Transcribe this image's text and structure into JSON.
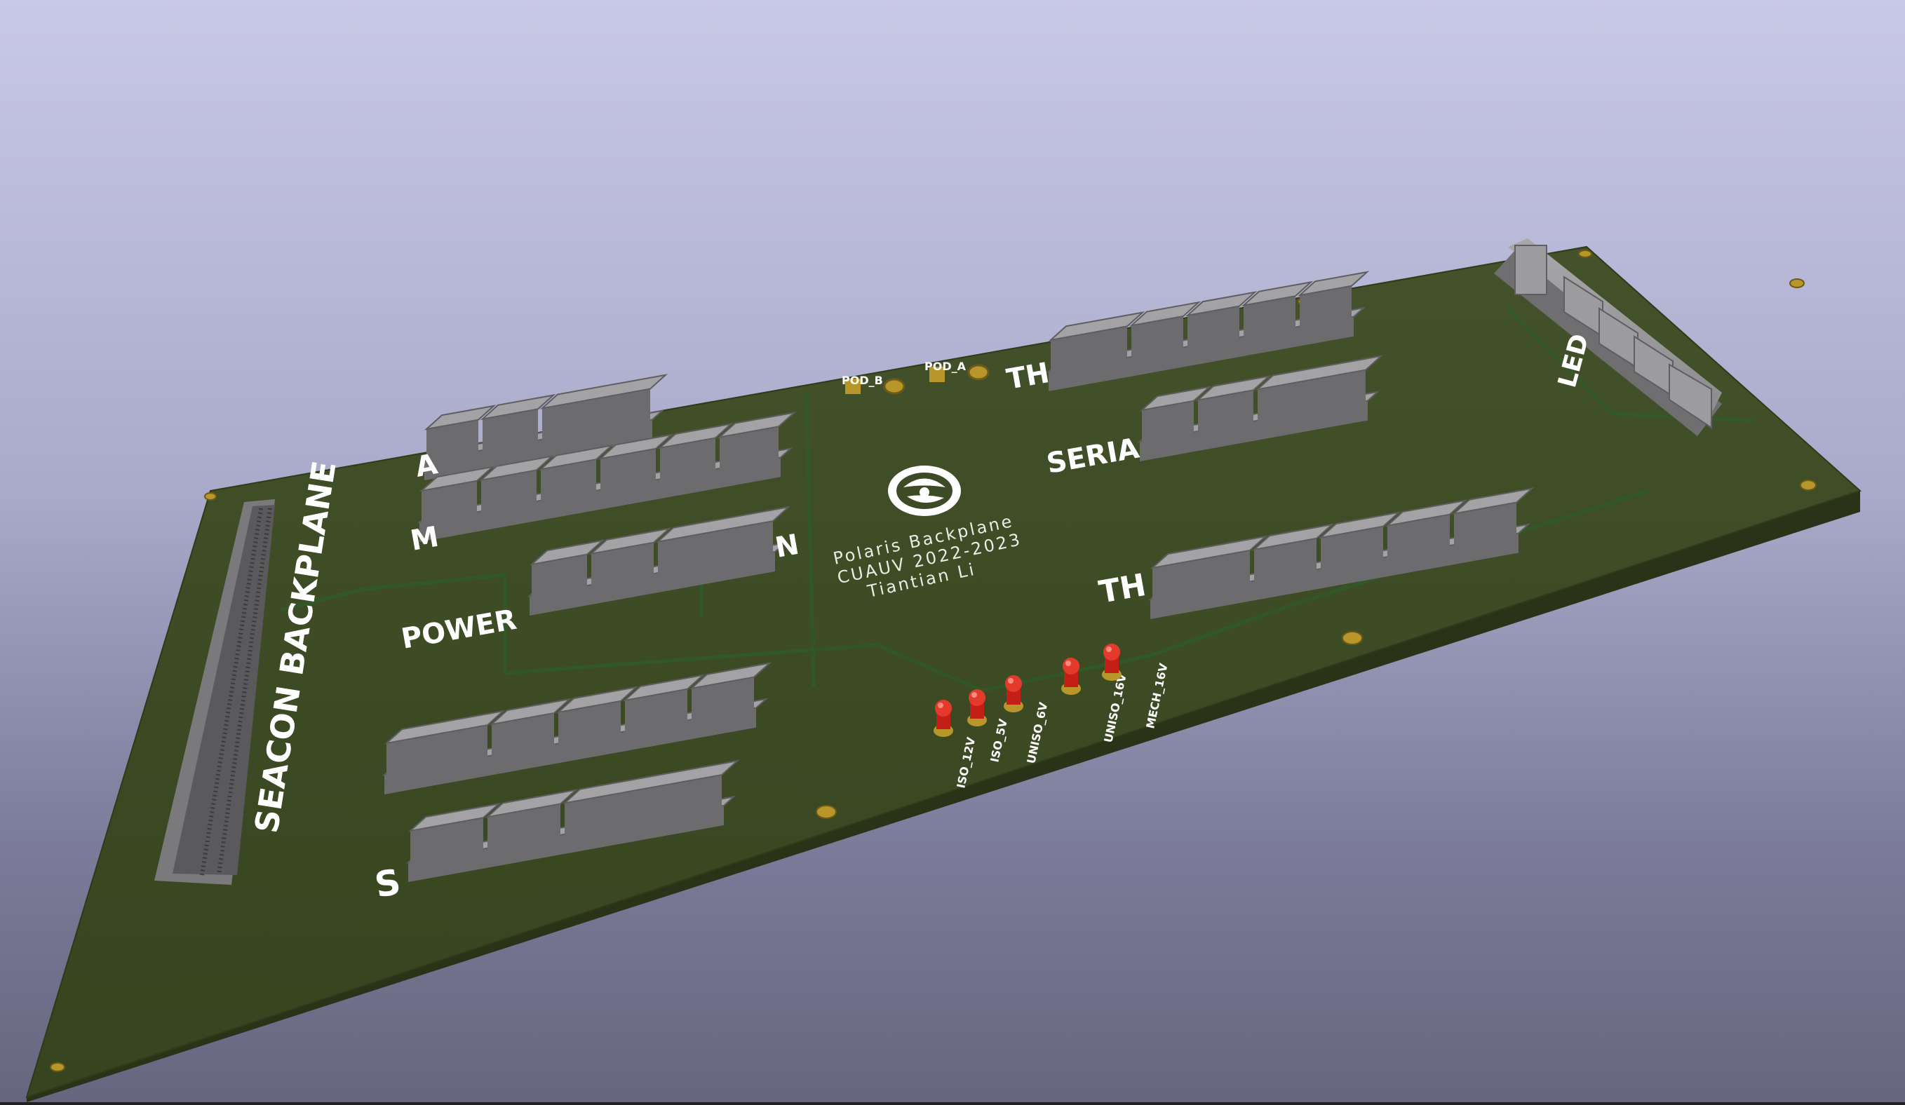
{
  "scene": {
    "board_labels": {
      "board_name": "SEACON BACKPLANE",
      "power": "POWER",
      "serial": "SERIA",
      "thruster_top": "TH",
      "thruster_bottom": "TH",
      "led": "LED",
      "partial_a": "A",
      "partial_m": "M",
      "partial_n": "N",
      "partial_s": "S"
    },
    "title_block": {
      "line1": "Polaris Backplane",
      "line2": "CUAUV 2022-2023",
      "line3": "Tiantian Li"
    },
    "test_pads": [
      "POD_B",
      "POD_A"
    ],
    "led_indicators": [
      "ISO_12V",
      "ISO_5V",
      "UNISO_6V",
      "UNISO_16V",
      "MECH_16V"
    ],
    "colors": {
      "background_top": "#c8c9e6",
      "background_bottom": "#66667f",
      "pcb": "#3c4a26",
      "connector": "#8a8a8c",
      "led": "#d8231a",
      "silkscreen": "#ffffff",
      "pad": "#b8962a"
    }
  }
}
